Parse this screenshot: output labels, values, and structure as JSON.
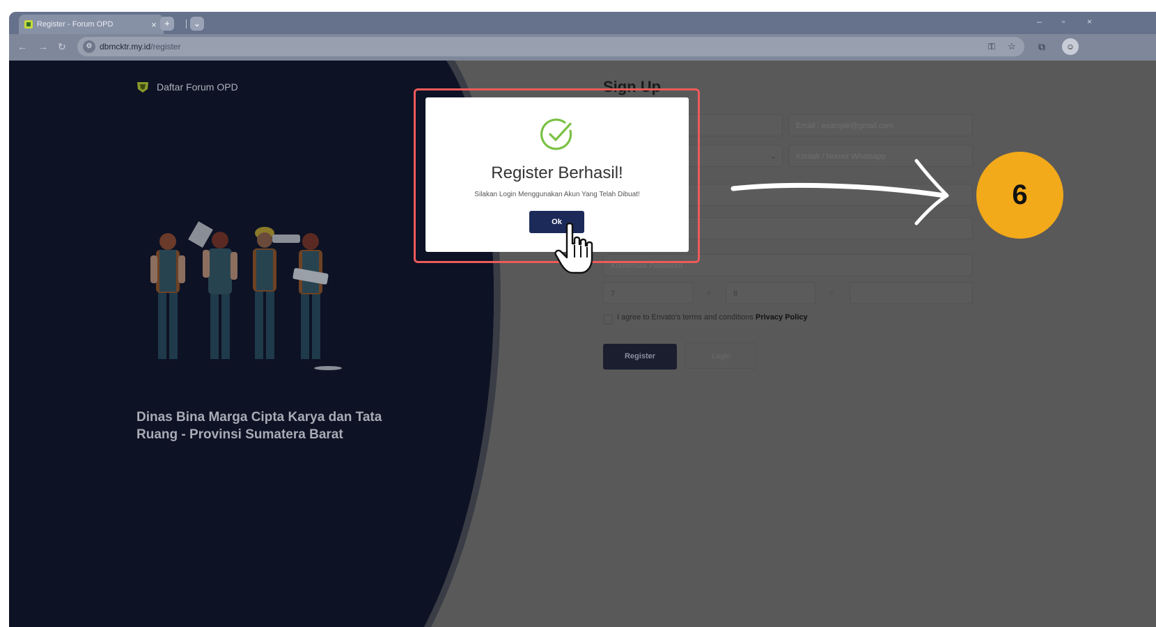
{
  "browser": {
    "tab_title": "Register - Forum OPD",
    "tab_close": "×",
    "new_tab": "+",
    "tab_search": "⌄",
    "url_domain": "dbmcktr.my.id",
    "url_path": "/register",
    "window_controls": [
      "–",
      "▫",
      "×"
    ]
  },
  "left_panel": {
    "brand": "Daftar Forum OPD",
    "tagline": "Dinas Bina Marga Cipta Karya dan Tata Ruang - Provinsi Sumatera Barat"
  },
  "form": {
    "title": "Sign Up",
    "fields": {
      "email_placeholder": "Email : example@gmail.com",
      "contact_placeholder": "Kontak / Nomor Whatsapp",
      "confirm_placeholder": "Konfirmasi Password"
    },
    "captcha": {
      "a": "7",
      "plus": "+",
      "b": "8",
      "equals": "="
    },
    "agree_text": "I agree to Envato's terms and conditions",
    "privacy_link": "Privacy Policy",
    "register_button": "Register",
    "login_button": "Login"
  },
  "modal": {
    "title": "Register Berhasil!",
    "message": "Silakan Login Menggunakan Akun Yang Telah Dibuat!",
    "ok_button": "Ok"
  },
  "annotation": {
    "step_number": "6",
    "highlight_color": "#ee5a5a",
    "badge_color": "#f2a91a"
  },
  "colors": {
    "modal_button": "#1c2a59",
    "success_check": "#7ac143",
    "left_panel_bg": "#0d1224",
    "overlay_bg": "#595959"
  }
}
